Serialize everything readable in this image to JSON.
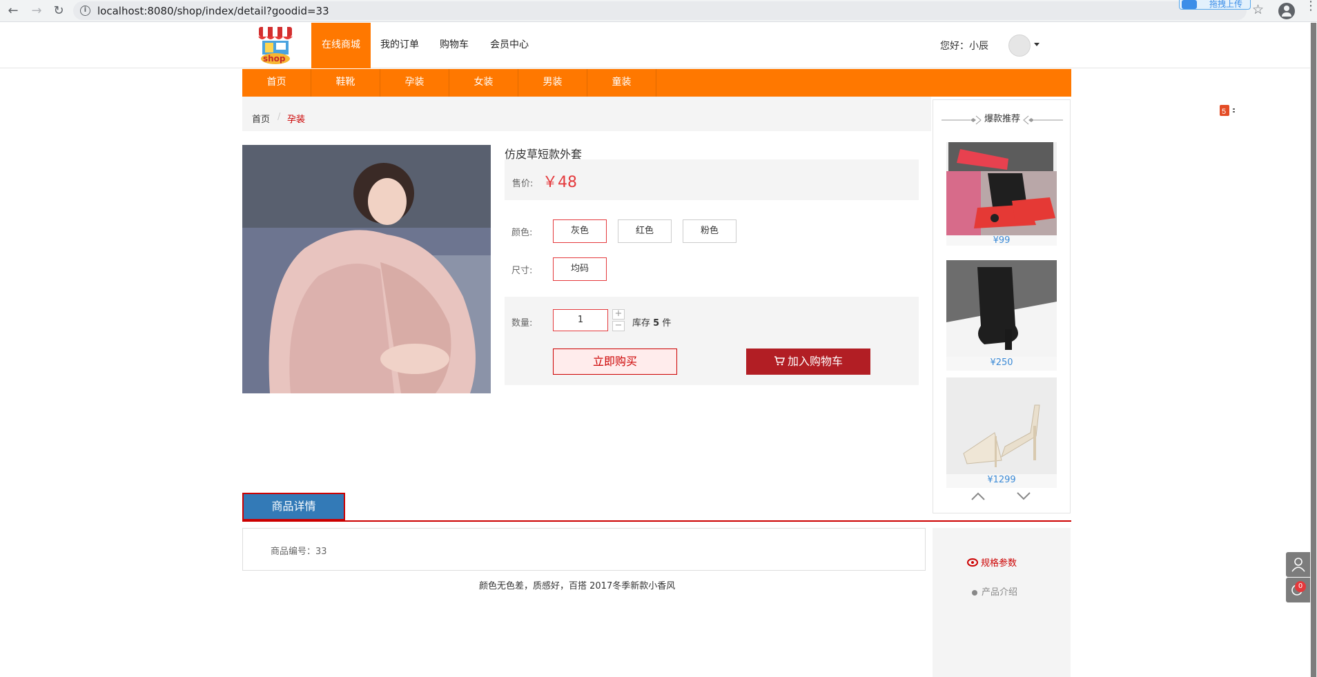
{
  "browser": {
    "url": "localhost:8080/shop/index/detail?goodid=33",
    "ext_upload_label": "拖拽上传"
  },
  "header": {
    "logo_text": "shop",
    "nav": [
      "在线商城",
      "我的订单",
      "购物车",
      "会员中心"
    ],
    "active_nav": "在线商城",
    "greeting": "您好：小辰"
  },
  "categories": [
    "首页",
    "鞋靴",
    "孕装",
    "女装",
    "男装",
    "童装"
  ],
  "breadcrumb": {
    "home": "首页",
    "current": "孕装"
  },
  "product": {
    "title": "仿皮草短款外套",
    "price_label": "售价:",
    "price": "￥48",
    "color_label": "颜色:",
    "colors": [
      "灰色",
      "红色",
      "粉色"
    ],
    "selected_color": "灰色",
    "size_label": "尺寸:",
    "sizes": [
      "均码"
    ],
    "selected_size": "均码",
    "qty_label": "数量:",
    "qty": "1",
    "stock_prefix": "库存",
    "stock": "5",
    "stock_unit": "件",
    "buy_label": "立即购买",
    "cart_label": "加入购物车"
  },
  "recommend": {
    "title": "爆款推荐",
    "items": [
      {
        "price": "¥99"
      },
      {
        "price": "¥250"
      },
      {
        "price": "¥1299"
      }
    ]
  },
  "detail": {
    "tab_label": "商品详情",
    "code_text": "商品编号：33",
    "description": "颜色无色差，质感好，百搭 2017冬季新款小香风",
    "side_items": [
      "规格参数",
      "产品介绍"
    ]
  },
  "float": {
    "cart_count": "0"
  },
  "colors": {
    "orange": "#ff7800",
    "red": "#c00",
    "blue": "#337ab7",
    "dark_red": "#b21e24"
  }
}
